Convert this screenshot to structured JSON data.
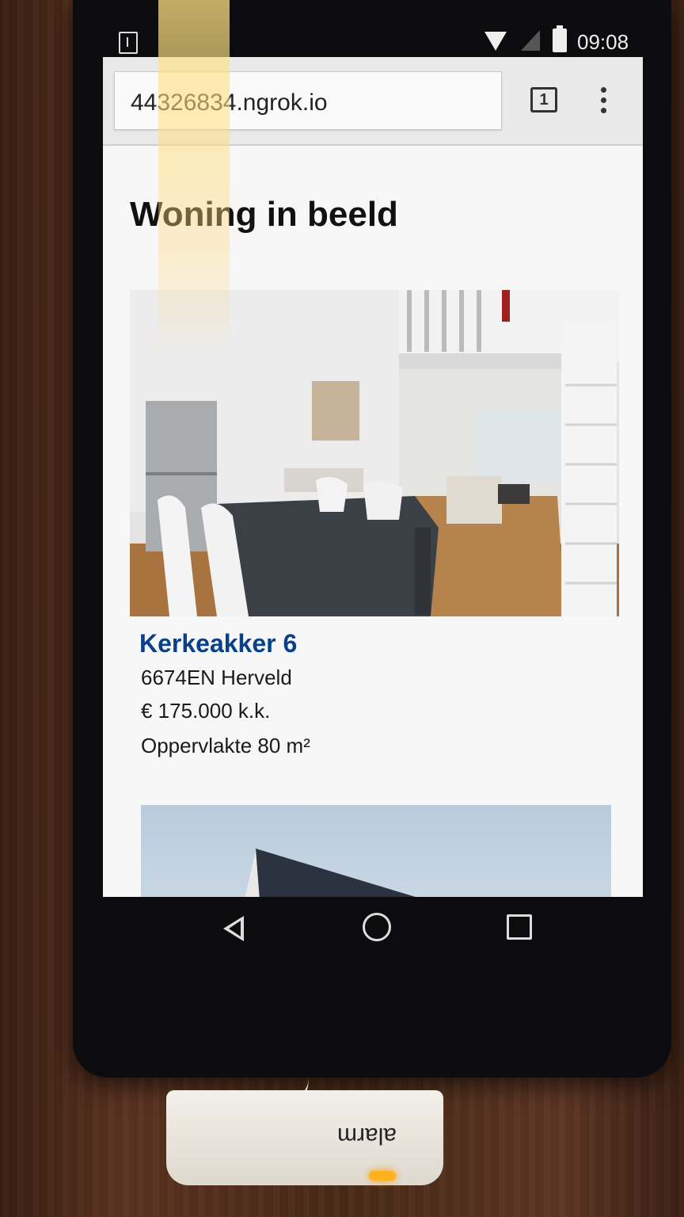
{
  "status_bar": {
    "time": "09:08",
    "icons": [
      "download-icon",
      "wifi-icon",
      "signal-icon",
      "battery-charging-icon"
    ]
  },
  "browser": {
    "url": "44326834.ngrok.io",
    "tab_count": "1",
    "menu_icon": "more-vert-icon"
  },
  "page": {
    "title": "Woning in beeld",
    "listing": {
      "address": "Kerkeakker 6",
      "postcode_city": "6674EN Herveld",
      "price": "€ 175.000 k.k.",
      "area": "Oppervlakte 80 m²"
    }
  },
  "nav_bar": {
    "icons": [
      "back-icon",
      "home-icon",
      "recents-icon"
    ]
  },
  "dock": {
    "label": "alarm"
  },
  "colors": {
    "link_blue": "#0a3f8a",
    "page_bg": "#f7f7f7",
    "toolbar_bg": "#e9e9e9"
  }
}
